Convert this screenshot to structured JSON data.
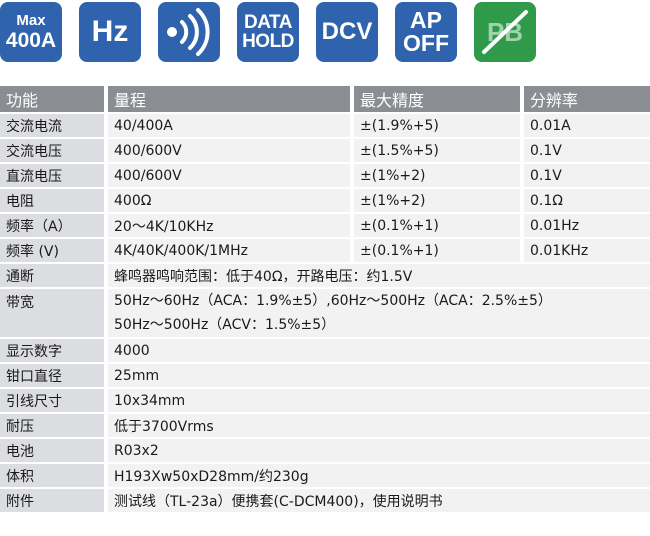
{
  "icons": [
    {
      "name": "max-400a-icon",
      "lines": [
        "Max",
        "400A"
      ],
      "color": "#2f63ae"
    },
    {
      "name": "hz-icon",
      "lines": [
        "Hz"
      ],
      "color": "#2f63ae"
    },
    {
      "name": "continuity-buzzer-icon",
      "lines": [],
      "color": "#2f63ae"
    },
    {
      "name": "data-hold-icon",
      "lines": [
        "DATA",
        "HOLD"
      ],
      "color": "#2f63ae"
    },
    {
      "name": "dcv-icon",
      "lines": [
        "DCV"
      ],
      "color": "#2f63ae"
    },
    {
      "name": "auto-power-off-icon",
      "lines": [
        "AP",
        "OFF"
      ],
      "color": "#2f63ae"
    },
    {
      "name": "no-lead-pb-icon",
      "lines": [
        "PB"
      ],
      "color": "#2f9a4a"
    }
  ],
  "table": {
    "headers": [
      "功能",
      "量程",
      "最大精度",
      "分辨率"
    ],
    "rows4": [
      [
        "交流电流",
        "40/400A",
        "±(1.9%+5)",
        "0.01A"
      ],
      [
        "交流电压",
        "400/600V",
        "±(1.5%+5)",
        "0.1V"
      ],
      [
        "直流电压",
        "400/600V",
        "±(1%+2)",
        "0.1V"
      ],
      [
        "电阻",
        "400Ω",
        "±(1%+2)",
        "0.1Ω"
      ],
      [
        "频率（A）",
        "20～4K/10KHz",
        "±(0.1%+1)",
        "0.01Hz"
      ],
      [
        "频率 (V)",
        "4K/40K/400K/1MHz",
        "±(0.1%+1)",
        "0.01KHz"
      ]
    ],
    "continuity": {
      "label": "通断",
      "value": "蜂鸣器鸣响范围：低于40Ω，开路电压：约1.5V"
    },
    "bandwidth": {
      "label": "带宽",
      "line1": "50Hz～60Hz（ACA：1.9%±5）,60Hz～500Hz（ACA：2.5%±5）",
      "line2": "50Hz～500Hz（ACV：1.5%±5）"
    },
    "rows2": [
      [
        "显示数字",
        "4000"
      ],
      [
        "钳口直径",
        "25mm"
      ],
      [
        "引线尺寸",
        "10x34mm"
      ],
      [
        "耐压",
        "低于3700Vrms"
      ],
      [
        "电池",
        "R03x2"
      ],
      [
        "体积",
        "H193Xw50xD28mm/约230g"
      ],
      [
        "附件",
        "测试线（TL-23a）便携套(C-DCM400)，使用说明书"
      ]
    ]
  }
}
